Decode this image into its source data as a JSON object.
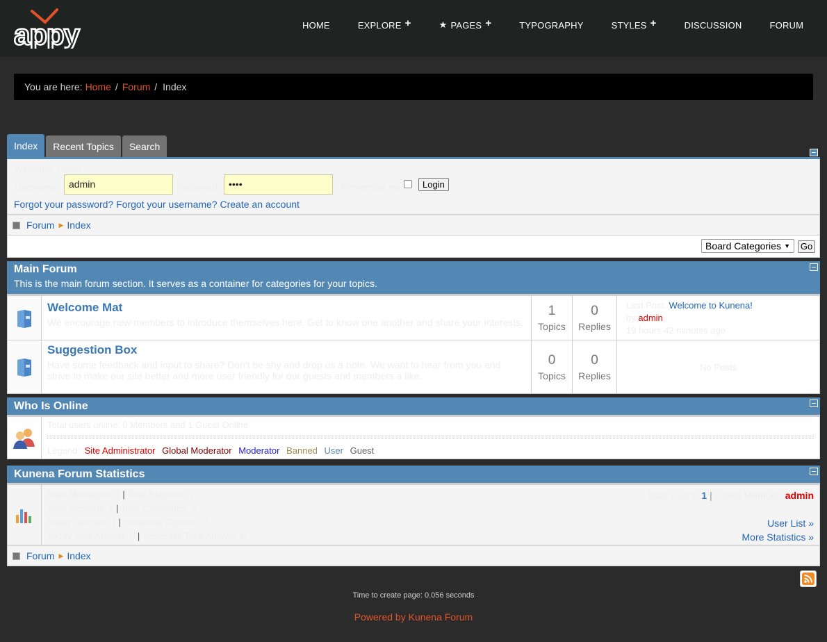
{
  "logo": {
    "text": "appy",
    "colors": {
      "ring": "#ffffff",
      "check": "#e0532b"
    }
  },
  "nav": [
    {
      "label": "HOME",
      "plus": false,
      "star": false
    },
    {
      "label": "EXPLORE",
      "plus": true,
      "star": false
    },
    {
      "label": "PAGES",
      "plus": true,
      "star": true
    },
    {
      "label": "TYPOGRAPHY",
      "plus": false,
      "star": false
    },
    {
      "label": "STYLES",
      "plus": true,
      "star": false
    },
    {
      "label": "DISCUSSION",
      "plus": false,
      "star": false
    },
    {
      "label": "FORUM",
      "plus": false,
      "star": false
    }
  ],
  "breadcrumb": {
    "prefix": "You are here:",
    "home": "Home",
    "forum": "Forum",
    "current": "Index"
  },
  "tabs": [
    "Index",
    "Recent Topics",
    "Search"
  ],
  "login": {
    "welcome": "Welcome, Guest",
    "username_label": "Username",
    "username_value": "admin",
    "password_label": "Password",
    "password_value": "••••",
    "remember_label": "Remember me",
    "login_button": "Login",
    "forgot_password": "Forgot your password?",
    "forgot_username": "Forgot your username?",
    "create_account": "Create an account"
  },
  "pathway": {
    "forum": "Forum",
    "index": "Index"
  },
  "category_select": {
    "selected": "Board Categories",
    "go": "Go"
  },
  "main_forum": {
    "title": "Main Forum",
    "description": "This is the main forum section. It serves as a container for categories for your topics.",
    "rows": [
      {
        "name": "Welcome Mat",
        "desc": "We encourage new members to introduce themselves here. Get to know one another and share your interests.",
        "topics": "1",
        "topics_label": "Topics",
        "replies": "0",
        "replies_label": "Replies",
        "last_post_label": "Last Post:",
        "last_post_title": "Welcome to Kunena!",
        "by_label": "by",
        "author": "admin",
        "time": "19 hours 42 minutes ago"
      },
      {
        "name": "Suggestion Box",
        "desc": "Have some feedback and input to share? Don't be shy and drop us a note. We want to hear from you and strive to make our site better and more user friendly for our guests and members a like.",
        "topics": "0",
        "topics_label": "Topics",
        "replies": "0",
        "replies_label": "Replies",
        "no_posts": "No Posts"
      }
    ]
  },
  "who_online": {
    "title": "Who Is Online",
    "summary_label": "Total users online:",
    "summary_value": "0 Members and 1 Guest Online",
    "legend_label": "Legend:",
    "legend": [
      {
        "label": "Site Administrator",
        "color": "#e00000"
      },
      {
        "label": "Global Moderator",
        "color": "#800000"
      },
      {
        "label": "Moderator",
        "color": "#2020d0"
      },
      {
        "label": "Banned",
        "color": "#a08a50"
      },
      {
        "label": "User",
        "color": "#5a8ab8"
      },
      {
        "label": "Guest",
        "color": "#666666"
      }
    ]
  },
  "stats": {
    "title": "Kunena Forum Statistics",
    "lines": [
      {
        "a": "Total Messages:",
        "av": "1",
        "b": "Total Subjects:",
        "bv": "1"
      },
      {
        "a": "Total Sections:",
        "av": "1",
        "b": "Total Categories:",
        "bv": "2"
      },
      {
        "a": "Today Opened:",
        "av": "1",
        "b": "Yesterday Opened:",
        "bv": "0"
      },
      {
        "a": "Today Total Answer:",
        "av": "0",
        "b": "Yesterday Total Answer:",
        "bv": "0"
      }
    ],
    "total_users_label": "Total Users:",
    "total_users_value": "1",
    "latest_member_label": "Latest Member:",
    "latest_member_value": "admin",
    "user_list": "User List »",
    "more_stats": "More Statistics »"
  },
  "footer": {
    "time_text": "Time to create page: 0.056 seconds",
    "powered": "Powered by Kunena Forum"
  }
}
